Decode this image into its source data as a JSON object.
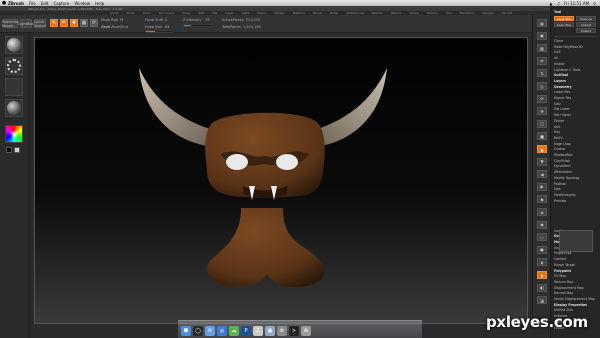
{
  "menubar": {
    "apple": "",
    "items": [
      "ZBrush",
      "File",
      "Edit",
      "Capture",
      "Window",
      "Help"
    ],
    "clock": "Fri 11:51 AM"
  },
  "titlebar": {
    "title": "ZBrush 4.0 - Active Mesh Count: 1,244,580 - Free Mem: 3.4 GB",
    "items": [
      "Alpha",
      "Brush",
      "Color",
      "Document",
      "Draw",
      "Edit",
      "File",
      "Layer",
      "Light",
      "Macro",
      "Marker",
      "Material",
      "Movie",
      "Picker",
      "Preferences",
      "Render",
      "Stencil",
      "Stroke",
      "Texture",
      "Tool",
      "Transform",
      "Zplugin",
      "Zscript"
    ]
  },
  "shelf": {
    "projection_master": "Projection Master",
    "lightbox": "LightBox",
    "quick_sketch": "Quick Sketch",
    "edit": "Edit",
    "draw": "Draw",
    "move": "Move",
    "scale": "Scale",
    "rotate": "Rotate",
    "mrgb": "Mrgb",
    "rgb": "Rgb",
    "m": "M",
    "zadd": "Zadd",
    "zsub": "Zsub",
    "zcut": "Zcut",
    "focal_shift_label": "Focal Shift",
    "focal_shift_value": "0",
    "draw_size_label": "Draw Size",
    "draw_size_value": "64",
    "z_intensity_label": "Z Intensity",
    "z_intensity_value": "25",
    "active_points": "ActivePoints: 311,040",
    "total_points": "TotalPoints: 1,244,160",
    "draw_size_fill": 0.35,
    "z_intensity_fill": 0.25
  },
  "right_tray": {
    "header": "Tool",
    "rows": [
      "Load Tool",
      "Save As",
      "Copy Tool",
      "Import",
      "Export",
      "Clone",
      "Make PolyMesh3D",
      "GoZ",
      "All",
      "Visible",
      "Lightbox > Tools",
      "SubTool",
      "Layers",
      "Geometry",
      "Lower Res",
      "Higher Res",
      "Sdiv",
      "Del Lower",
      "Del Higher",
      "Divide",
      "Smt",
      "Suv",
      "ReUV",
      "Edge Loop",
      "Crease",
      "ShadowBox",
      "ClayPolish",
      "DynaMesh",
      "ZRemesher",
      "Modify Topology",
      "Position",
      "Size",
      "MeshIntegrity",
      "Preview",
      "Surface",
      "Deformation",
      "Masking",
      "Visibility",
      "Polygroups",
      "Contact",
      "Morph Target",
      "Polypaint",
      "UV Map",
      "Texture Map",
      "Displacement Map",
      "Normal Map",
      "Vector Displacement Map",
      "Display Properties",
      "Unified Skin",
      "Initialize",
      "Import",
      "Export"
    ]
  },
  "dock": {
    "apps": [
      "Finder",
      "Dashboard",
      "Mail",
      "Safari",
      "iChat",
      "Photoshop",
      "ZBrush",
      "Preview",
      "System Preferences",
      "Terminal",
      "Trash"
    ]
  },
  "colors": {
    "accent": "#e2751b",
    "ui_bg": "#2b2b2b",
    "model": "#6b3d1c",
    "horn": "#9a8c7a"
  },
  "watermark": "pxleyes.com"
}
